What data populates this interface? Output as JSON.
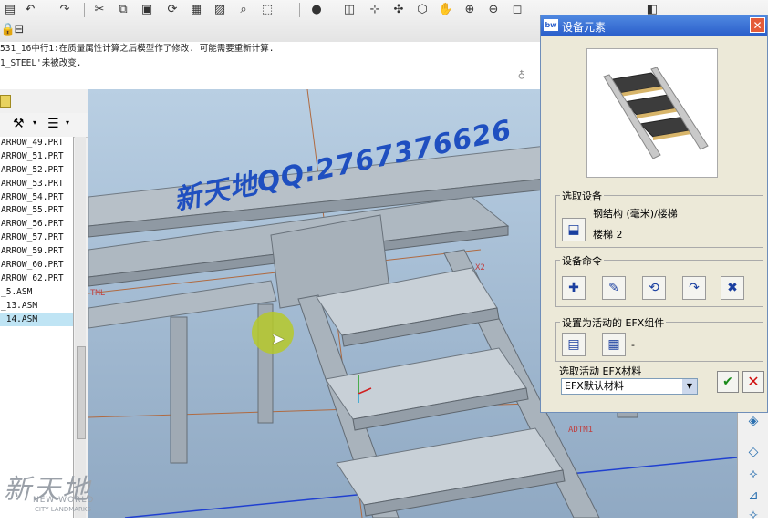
{
  "messages": {
    "line1": "531_16中行1:在质量属性计算之后模型作了修改. 可能需要重新计算.",
    "line2": "1_STEEL'未被改变."
  },
  "tree": {
    "items": [
      "ARROW_49.PRT",
      "ARROW_51.PRT",
      "ARROW_52.PRT",
      "ARROW_53.PRT",
      "ARROW_54.PRT",
      "ARROW_55.PRT",
      "ARROW_56.PRT",
      "ARROW_57.PRT",
      "ARROW_59.PRT",
      "ARROW_60.PRT",
      "ARROW_62.PRT",
      "_5.ASM",
      "_13.ASM",
      "_14.ASM"
    ],
    "selected_index": 13
  },
  "dialog": {
    "title": "设备元素",
    "close_glyph": "✕",
    "logo_text": "bw",
    "select_group_label": "选取设备",
    "equipment_path": "钢结构 (毫米)/楼梯",
    "equipment_name": "楼梯 2",
    "commands_label": "设备命令",
    "active_efx_label": "设置为活动的 EFX组件",
    "active_efx_value": "-",
    "material_label": "选取活动 EFX材料",
    "material_value": "EFX默认材料",
    "colors": {
      "title_bar": "#2b5fcb",
      "ok": "#1a8a1a",
      "cancel": "#d01010"
    }
  },
  "viewport": {
    "labels": {
      "datum1": "ADTM1",
      "datum2": "TML",
      "axis": "X2"
    }
  },
  "watermark": {
    "text": "新天地QQ:2767376626",
    "logo_cn": "新天地",
    "logo_en": "NEW WORLD",
    "logo_en2": "CITY LANDMARKS"
  },
  "icons": {
    "toolbar": [
      "undo-icon",
      "redo-icon",
      "cut-icon",
      "copy-icon",
      "paste-icon",
      "regen-icon",
      "find-icon",
      "select-box-icon",
      "shade-icon",
      "datum-icon",
      "spin-icon",
      "pan-icon",
      "zoom-in-icon",
      "zoom-out-icon",
      "refit-icon"
    ]
  }
}
